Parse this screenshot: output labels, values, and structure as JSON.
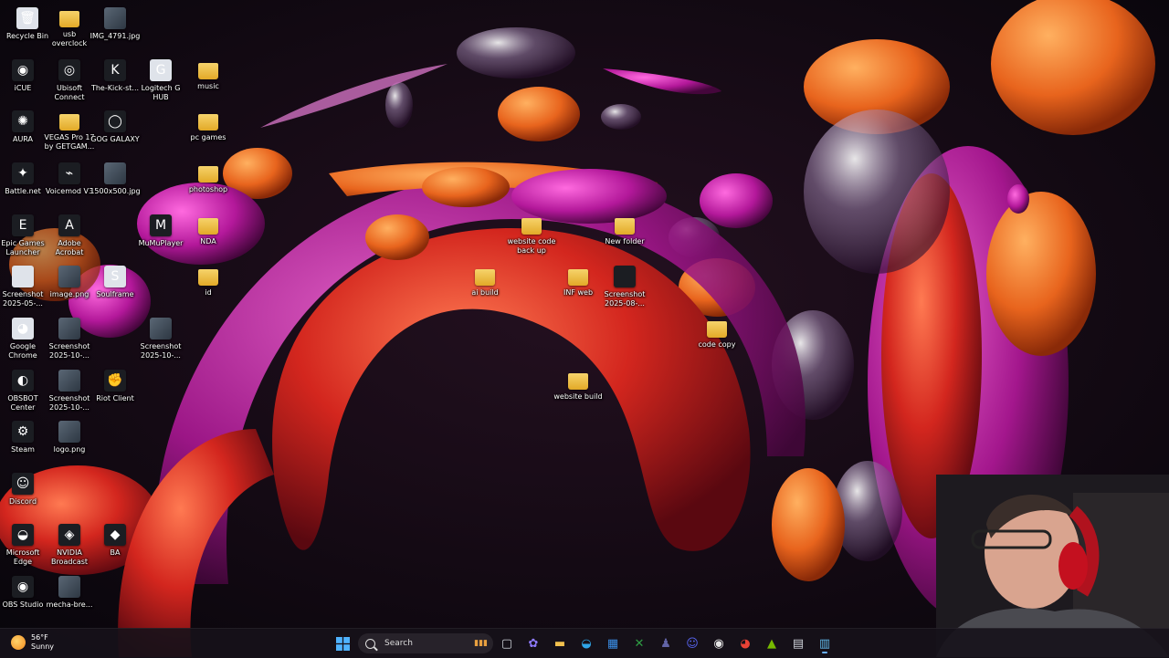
{
  "desktop_icons": [
    {
      "name": "recycle-bin",
      "label": "Recycle Bin",
      "glyph": "🗑",
      "kind": "file",
      "color": "#dfe3ea"
    },
    {
      "name": "usb-overclock",
      "label": "usb\noverclock",
      "glyph": "",
      "kind": "folder"
    },
    {
      "name": "img-4791",
      "label": "IMG_4791.jpg",
      "glyph": "",
      "kind": "img"
    },
    {
      "name": "icue",
      "label": "iCUE",
      "glyph": "◉",
      "kind": "dark"
    },
    {
      "name": "ubisoft-connect",
      "label": "Ubisoft\nConnect",
      "glyph": "◎",
      "kind": "dark"
    },
    {
      "name": "kick-streamer",
      "label": "The-Kick-st...",
      "glyph": "K",
      "kind": "dark"
    },
    {
      "name": "logitech-g-hub",
      "label": "Logitech G\nHUB",
      "glyph": "G",
      "kind": "file"
    },
    {
      "name": "music",
      "label": "music",
      "glyph": "",
      "kind": "folder"
    },
    {
      "name": "aura",
      "label": "AURA",
      "glyph": "✺",
      "kind": "dark"
    },
    {
      "name": "vegas-pro",
      "label": "VEGAS Pro 17\nby GETGAM...",
      "glyph": "",
      "kind": "folder"
    },
    {
      "name": "gog-galaxy",
      "label": "GOG GALAXY",
      "glyph": "◯",
      "kind": "dark"
    },
    {
      "name": "pc-games",
      "label": "pc games",
      "glyph": "",
      "kind": "folder"
    },
    {
      "name": "battle-net",
      "label": "Battle.net",
      "glyph": "✦",
      "kind": "dark"
    },
    {
      "name": "voicemod",
      "label": "Voicemod V3",
      "glyph": "⌁",
      "kind": "dark"
    },
    {
      "name": "img-1500",
      "label": "1500x500.jpg",
      "glyph": "",
      "kind": "img"
    },
    {
      "name": "photoshop",
      "label": "photoshop",
      "glyph": "",
      "kind": "folder"
    },
    {
      "name": "epic-games",
      "label": "Epic Games\nLauncher",
      "glyph": "E",
      "kind": "dark"
    },
    {
      "name": "adobe-acrobat",
      "label": "Adobe\nAcrobat",
      "glyph": "A",
      "kind": "dark"
    },
    {
      "name": "mumuplayer",
      "label": "MuMuPlayer",
      "glyph": "M",
      "kind": "dark"
    },
    {
      "name": "nda",
      "label": "NDA",
      "glyph": "",
      "kind": "folder"
    },
    {
      "name": "screenshot-2025-05",
      "label": "Screenshot\n2025-05-...",
      "glyph": "",
      "kind": "file"
    },
    {
      "name": "image-png",
      "label": "image.png",
      "glyph": "",
      "kind": "img"
    },
    {
      "name": "soulframe",
      "label": "Soulframe",
      "glyph": "S",
      "kind": "file"
    },
    {
      "name": "id-folder",
      "label": "id",
      "glyph": "",
      "kind": "folder"
    },
    {
      "name": "google-chrome",
      "label": "Google\nChrome",
      "glyph": "◕",
      "kind": "file"
    },
    {
      "name": "screenshot-2025-10-a",
      "label": "Screenshot\n2025-10-...",
      "glyph": "",
      "kind": "img"
    },
    {
      "name": "screenshot-2025-10-b",
      "label": "Screenshot\n2025-10-...",
      "glyph": "",
      "kind": "img"
    },
    {
      "name": "obsbot-center",
      "label": "OBSBOT\nCenter",
      "glyph": "◐",
      "kind": "dark"
    },
    {
      "name": "screenshot-2025-10-c",
      "label": "Screenshot\n2025-10-...",
      "glyph": "",
      "kind": "img"
    },
    {
      "name": "riot-client",
      "label": "Riot Client",
      "glyph": "✊",
      "kind": "dark"
    },
    {
      "name": "steam",
      "label": "Steam",
      "glyph": "⚙",
      "kind": "dark"
    },
    {
      "name": "logo-png",
      "label": "logo.png",
      "glyph": "",
      "kind": "img"
    },
    {
      "name": "discord",
      "label": "Discord",
      "glyph": "☺",
      "kind": "dark"
    },
    {
      "name": "microsoft-edge",
      "label": "Microsoft\nEdge",
      "glyph": "◒",
      "kind": "dark"
    },
    {
      "name": "nvidia-broadcast",
      "label": "NVIDIA\nBroadcast",
      "glyph": "◈",
      "kind": "dark"
    },
    {
      "name": "ba",
      "label": "BA",
      "glyph": "◆",
      "kind": "dark"
    },
    {
      "name": "obs-studio",
      "label": "OBS Studio",
      "glyph": "◉",
      "kind": "dark"
    },
    {
      "name": "mecha-break",
      "label": "mecha-bre...",
      "glyph": "",
      "kind": "img"
    },
    {
      "name": "website-code-back-up",
      "label": "website code\nback up",
      "glyph": "",
      "kind": "folder"
    },
    {
      "name": "new-folder",
      "label": "New folder",
      "glyph": "",
      "kind": "folder"
    },
    {
      "name": "ai-build",
      "label": "ai build",
      "glyph": "",
      "kind": "folder"
    },
    {
      "name": "inf-web",
      "label": "INF web",
      "glyph": "",
      "kind": "folder"
    },
    {
      "name": "screenshot-2025-08",
      "label": "Screenshot\n2025-08-...",
      "glyph": "",
      "kind": "dark"
    },
    {
      "name": "code-copy",
      "label": "code copy",
      "glyph": "",
      "kind": "folder"
    },
    {
      "name": "website-build",
      "label": "website build",
      "glyph": "",
      "kind": "folder"
    }
  ],
  "taskbar": {
    "weather": {
      "temp": "56°F",
      "condition": "Sunny"
    },
    "search_label": "Search",
    "pinned": [
      {
        "name": "task-view-icon",
        "glyph": "▢",
        "color": "#cfd3da"
      },
      {
        "name": "copilot-icon",
        "glyph": "✿",
        "color": "#8f7bff"
      },
      {
        "name": "file-explorer-icon",
        "glyph": "▬",
        "color": "#f2c14e"
      },
      {
        "name": "edge-icon",
        "glyph": "◒",
        "color": "#2fa6e8"
      },
      {
        "name": "store-icon",
        "glyph": "▦",
        "color": "#3a8ee6"
      },
      {
        "name": "xbox-icon",
        "glyph": "✕",
        "color": "#2f9e44"
      },
      {
        "name": "teams-icon",
        "glyph": "♟",
        "color": "#6264a7"
      },
      {
        "name": "discord-icon",
        "glyph": "☺",
        "color": "#5865f2"
      },
      {
        "name": "obs-icon",
        "glyph": "◉",
        "color": "#e6e6e6"
      },
      {
        "name": "chrome-icon",
        "glyph": "◕",
        "color": "#e94235"
      },
      {
        "name": "nvidia-icon",
        "glyph": "▲",
        "color": "#76b900"
      },
      {
        "name": "terminal-icon",
        "glyph": "▤",
        "color": "#cfd3da"
      },
      {
        "name": "notepad-icon",
        "glyph": "▥",
        "color": "#61b8e8"
      }
    ]
  }
}
